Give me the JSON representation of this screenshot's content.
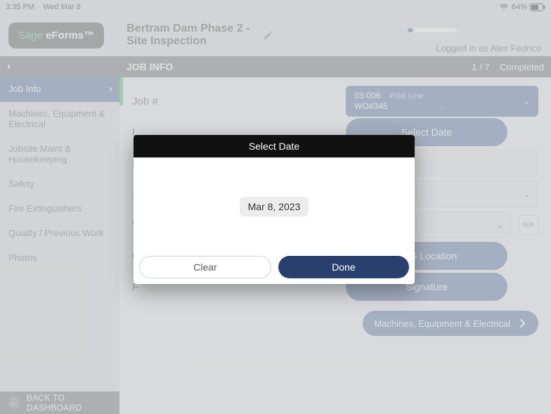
{
  "status": {
    "time": "3:35 PM",
    "date": "Wed Mar 8",
    "battery": "64%"
  },
  "brand": {
    "sage": "Sage",
    "eforms": "eForms™"
  },
  "header": {
    "title": "Bertram Dam Phase 2 - Site Inspection",
    "loggedin": "Logged in as Alex Fedrico"
  },
  "sidebar_header": {
    "title": "JOB INFO",
    "progress": "1 / 7",
    "state": "Completed"
  },
  "sidebar": {
    "items": [
      {
        "label": "Job Info"
      },
      {
        "label": "Machines, Equipment & Electrical"
      },
      {
        "label": "Jobsite Maint & Housekeeping"
      },
      {
        "label": "Safety"
      },
      {
        "label": "Fire Extinguishers"
      },
      {
        "label": "Quality / Previous Work"
      },
      {
        "label": "Photos"
      }
    ],
    "back": "BACK TO DASHBOARD"
  },
  "form": {
    "job_number_label": "Job #",
    "job_dropdown_line1": "03-006",
    "job_dropdown_line2": "PGE Line",
    "job_dropdown_line3": "WO#345",
    "job_dropdown_ell": "...",
    "select_date_btn": "Select Date",
    "gps_btn": "GPS Location",
    "signature_btn": "Signature",
    "na": "N/A",
    "next_section": "Machines, Equipment & Electrical"
  },
  "modal": {
    "title": "Select Date",
    "date_value": "Mar 8, 2023",
    "clear": "Clear",
    "done": "Done"
  }
}
